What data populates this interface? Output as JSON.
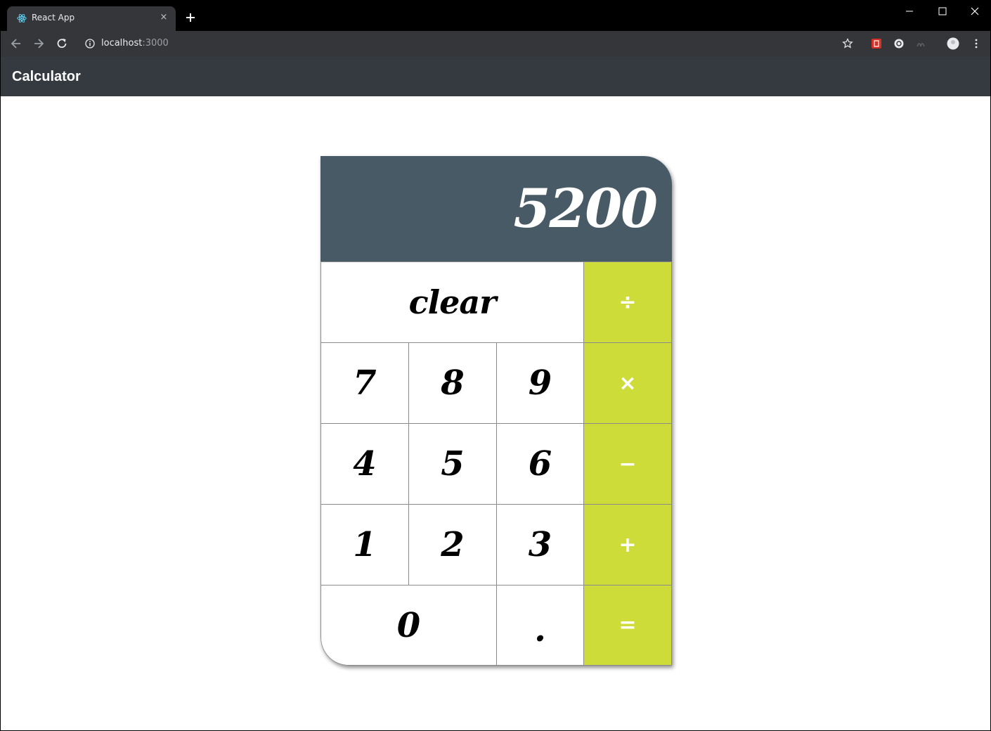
{
  "browser": {
    "tab_title": "React App",
    "tab_close": "×",
    "url_host": "localhost",
    "url_port": ":3000"
  },
  "app": {
    "brand": "Calculator"
  },
  "calculator": {
    "display": "5200",
    "keys": {
      "clear": "clear",
      "divide": "÷",
      "multiply": "×",
      "subtract": "−",
      "add": "+",
      "equals": "=",
      "seven": "7",
      "eight": "8",
      "nine": "9",
      "four": "4",
      "five": "5",
      "six": "6",
      "one": "1",
      "two": "2",
      "three": "3",
      "zero": "0",
      "decimal": "."
    },
    "colors": {
      "display_bg": "#475a66",
      "operator_bg": "#cddc39",
      "navbar_bg": "#343a40"
    }
  }
}
